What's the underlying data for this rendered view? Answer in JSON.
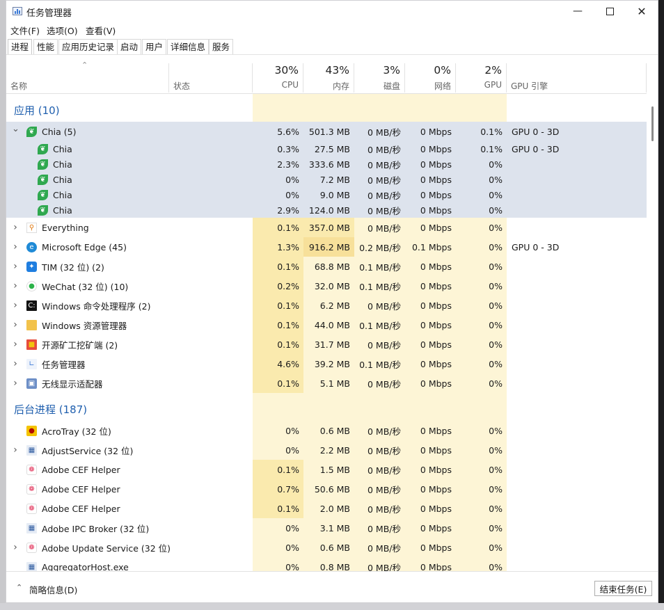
{
  "window": {
    "title": "任务管理器"
  },
  "menu": [
    "文件(F)",
    "选项(O)",
    "查看(V)"
  ],
  "tabs": [
    "进程",
    "性能",
    "应用历史记录",
    "启动",
    "用户",
    "详细信息",
    "服务"
  ],
  "columns": {
    "name": "名称",
    "status": "状态",
    "cpu": {
      "pct": "30%",
      "label": "CPU"
    },
    "mem": {
      "pct": "43%",
      "label": "内存"
    },
    "disk": {
      "pct": "3%",
      "label": "磁盘"
    },
    "net": {
      "pct": "0%",
      "label": "网络"
    },
    "gpu": {
      "pct": "2%",
      "label": "GPU"
    },
    "gpu_engine": "GPU 引擎"
  },
  "rows": [
    {
      "type": "group",
      "name": "应用 (10)"
    },
    {
      "type": "proc",
      "name": "Chia (5)",
      "icon": "leaf-icon",
      "chev": "down",
      "sel": true,
      "cpu": "5.6%",
      "mem": "501.3 MB",
      "disk": "0 MB/秒",
      "net": "0 Mbps",
      "gpu": "0.1%",
      "gpu_engine": "GPU 0 - 3D"
    },
    {
      "type": "child",
      "name": "Chia",
      "icon": "leaf-icon",
      "sel": true,
      "cpu": "0.3%",
      "mem": "27.5 MB",
      "disk": "0 MB/秒",
      "net": "0 Mbps",
      "gpu": "0.1%",
      "gpu_engine": "GPU 0 - 3D"
    },
    {
      "type": "child",
      "name": "Chia",
      "icon": "leaf-icon",
      "sel": true,
      "cpu": "2.3%",
      "mem": "333.6 MB",
      "disk": "0 MB/秒",
      "net": "0 Mbps",
      "gpu": "0%",
      "gpu_engine": ""
    },
    {
      "type": "child",
      "name": "Chia",
      "icon": "leaf-icon",
      "sel": true,
      "cpu": "0%",
      "mem": "7.2 MB",
      "disk": "0 MB/秒",
      "net": "0 Mbps",
      "gpu": "0%",
      "gpu_engine": ""
    },
    {
      "type": "child",
      "name": "Chia",
      "icon": "leaf-icon",
      "sel": true,
      "cpu": "0%",
      "mem": "9.0 MB",
      "disk": "0 MB/秒",
      "net": "0 Mbps",
      "gpu": "0%",
      "gpu_engine": ""
    },
    {
      "type": "child",
      "name": "Chia",
      "icon": "leaf-icon",
      "sel": true,
      "cpu": "2.9%",
      "mem": "124.0 MB",
      "disk": "0 MB/秒",
      "net": "0 Mbps",
      "gpu": "0%",
      "gpu_engine": ""
    },
    {
      "type": "proc",
      "name": "Everything",
      "icon": "magnifier-icon",
      "chev": "right",
      "cpu": "0.1%",
      "mem": "357.0 MB",
      "disk": "0 MB/秒",
      "net": "0 Mbps",
      "gpu": "0%",
      "gpu_engine": ""
    },
    {
      "type": "proc",
      "name": "Microsoft Edge (45)",
      "icon": "edge-icon",
      "chev": "right",
      "cpu": "1.3%",
      "mem": "916.2 MB",
      "disk": "0.2 MB/秒",
      "net": "0.1 Mbps",
      "gpu": "0%",
      "gpu_engine": "GPU 0 - 3D",
      "hotmem": true
    },
    {
      "type": "proc",
      "name": "TIM (32 位) (2)",
      "icon": "tim-icon",
      "chev": "right",
      "cpu": "0.1%",
      "mem": "68.8 MB",
      "disk": "0.1 MB/秒",
      "net": "0 Mbps",
      "gpu": "0%",
      "gpu_engine": ""
    },
    {
      "type": "proc",
      "name": "WeChat (32 位) (10)",
      "icon": "wechat-icon",
      "chev": "right",
      "cpu": "0.2%",
      "mem": "32.0 MB",
      "disk": "0.1 MB/秒",
      "net": "0 Mbps",
      "gpu": "0%",
      "gpu_engine": ""
    },
    {
      "type": "proc",
      "name": "Windows 命令处理程序 (2)",
      "icon": "cmd-icon",
      "chev": "right",
      "cpu": "0.1%",
      "mem": "6.2 MB",
      "disk": "0 MB/秒",
      "net": "0 Mbps",
      "gpu": "0%",
      "gpu_engine": ""
    },
    {
      "type": "proc",
      "name": "Windows 资源管理器",
      "icon": "folder-icon",
      "chev": "right",
      "cpu": "0.1%",
      "mem": "44.0 MB",
      "disk": "0.1 MB/秒",
      "net": "0 Mbps",
      "gpu": "0%",
      "gpu_engine": ""
    },
    {
      "type": "proc",
      "name": "开源矿工挖矿端 (2)",
      "icon": "cube-icon",
      "chev": "right",
      "cpu": "0.1%",
      "mem": "31.7 MB",
      "disk": "0 MB/秒",
      "net": "0 Mbps",
      "gpu": "0%",
      "gpu_engine": ""
    },
    {
      "type": "proc",
      "name": "任务管理器",
      "icon": "taskmgr-icon",
      "chev": "right",
      "cpu": "4.6%",
      "mem": "39.2 MB",
      "disk": "0.1 MB/秒",
      "net": "0 Mbps",
      "gpu": "0%",
      "gpu_engine": ""
    },
    {
      "type": "proc",
      "name": "无线显示适配器",
      "icon": "display-icon",
      "chev": "right",
      "cpu": "0.1%",
      "mem": "5.1 MB",
      "disk": "0 MB/秒",
      "net": "0 Mbps",
      "gpu": "0%",
      "gpu_engine": ""
    },
    {
      "type": "group",
      "name": "后台进程 (187)"
    },
    {
      "type": "proc",
      "name": "AcroTray (32 位)",
      "icon": "acrotray-icon",
      "chev": "",
      "cpu": "0%",
      "mem": "0.6 MB",
      "disk": "0 MB/秒",
      "net": "0 Mbps",
      "gpu": "0%",
      "gpu_engine": ""
    },
    {
      "type": "proc",
      "name": "AdjustService (32 位)",
      "icon": "service-icon",
      "chev": "right",
      "cpu": "0%",
      "mem": "2.2 MB",
      "disk": "0 MB/秒",
      "net": "0 Mbps",
      "gpu": "0%",
      "gpu_engine": ""
    },
    {
      "type": "proc",
      "name": "Adobe CEF Helper",
      "icon": "adobe-cloud-icon",
      "chev": "",
      "cpu": "0.1%",
      "mem": "1.5 MB",
      "disk": "0 MB/秒",
      "net": "0 Mbps",
      "gpu": "0%",
      "gpu_engine": ""
    },
    {
      "type": "proc",
      "name": "Adobe CEF Helper",
      "icon": "adobe-cloud-icon",
      "chev": "",
      "cpu": "0.7%",
      "mem": "50.6 MB",
      "disk": "0 MB/秒",
      "net": "0 Mbps",
      "gpu": "0%",
      "gpu_engine": ""
    },
    {
      "type": "proc",
      "name": "Adobe CEF Helper",
      "icon": "adobe-cloud-icon",
      "chev": "",
      "cpu": "0.1%",
      "mem": "2.0 MB",
      "disk": "0 MB/秒",
      "net": "0 Mbps",
      "gpu": "0%",
      "gpu_engine": ""
    },
    {
      "type": "proc",
      "name": "Adobe IPC Broker (32 位)",
      "icon": "service-icon",
      "chev": "",
      "cpu": "0%",
      "mem": "3.1 MB",
      "disk": "0 MB/秒",
      "net": "0 Mbps",
      "gpu": "0%",
      "gpu_engine": ""
    },
    {
      "type": "proc",
      "name": "Adobe Update Service (32 位)",
      "icon": "adobe-cloud-icon",
      "chev": "right",
      "cpu": "0%",
      "mem": "0.6 MB",
      "disk": "0 MB/秒",
      "net": "0 Mbps",
      "gpu": "0%",
      "gpu_engine": ""
    },
    {
      "type": "proc",
      "name": "AggregatorHost.exe",
      "icon": "service-icon",
      "chev": "",
      "cpu": "0%",
      "mem": "0.8 MB",
      "disk": "0 MB/秒",
      "net": "0 Mbps",
      "gpu": "0%",
      "gpu_engine": ""
    }
  ],
  "footer": {
    "less_details": "简略信息(D)",
    "end_task": "结束任务(E)"
  },
  "colors": {
    "accent": "#1f5fae",
    "heat_low": "#fdf5d6",
    "heat_mid": "#faeaae",
    "heat_high": "#f7e09a",
    "selected": "#dde3ed"
  }
}
